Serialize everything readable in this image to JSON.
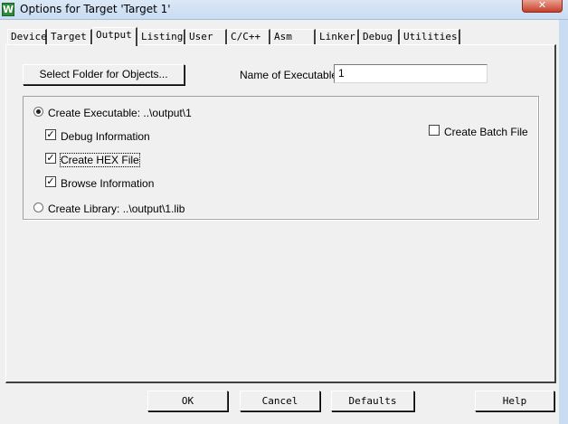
{
  "window": {
    "icon_glyph": "W",
    "title": "Options for Target 'Target 1'",
    "close_glyph": "✕"
  },
  "tabs": [
    {
      "label": "Device"
    },
    {
      "label": "Target"
    },
    {
      "label": "Output"
    },
    {
      "label": "Listing"
    },
    {
      "label": "User"
    },
    {
      "label": "C/C++"
    },
    {
      "label": "Asm"
    },
    {
      "label": "Linker"
    },
    {
      "label": "Debug"
    },
    {
      "label": "Utilities"
    }
  ],
  "active_tab": "Output",
  "output": {
    "select_folder_label": "Select Folder for Objects...",
    "name_label": "Name of Executable:",
    "name_value": "1",
    "create_executable_label": "Create Executable:  ..\\output\\1",
    "create_executable_selected": true,
    "debug_info_label": "Debug Information",
    "debug_info_checked": true,
    "create_hex_label": "Create HEX File",
    "create_hex_checked": true,
    "browse_info_label": "Browse Information",
    "browse_info_checked": true,
    "create_batch_label": "Create Batch File",
    "create_batch_checked": false,
    "create_library_label": "Create Library:  ..\\output\\1.lib",
    "create_library_selected": false
  },
  "footer": {
    "ok_label": "OK",
    "cancel_label": "Cancel",
    "defaults_label": "Defaults",
    "help_label": "Help"
  }
}
